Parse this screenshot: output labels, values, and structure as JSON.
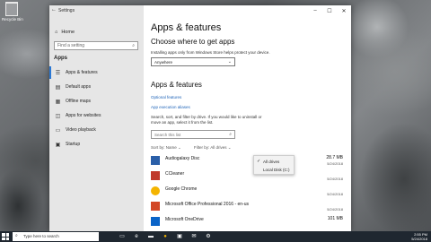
{
  "desktop": {
    "recycle_bin_label": "Recycle Bin"
  },
  "window": {
    "title": "Settings",
    "back_glyph": "←",
    "minimize_glyph": "–",
    "maximize_glyph": "☐",
    "close_glyph": "✕"
  },
  "sidebar": {
    "home_label": "Home",
    "search_placeholder": "Find a setting",
    "section_title": "Apps",
    "items": [
      {
        "label": "Apps & features",
        "icon": "list-icon",
        "active": true
      },
      {
        "label": "Default apps",
        "icon": "default-apps-icon"
      },
      {
        "label": "Offline maps",
        "icon": "map-icon"
      },
      {
        "label": "Apps for websites",
        "icon": "globe-icon"
      },
      {
        "label": "Video playback",
        "icon": "video-icon"
      },
      {
        "label": "Startup",
        "icon": "startup-icon"
      }
    ]
  },
  "main": {
    "page_title": "Apps & features",
    "install_heading": "Choose where to get apps",
    "install_desc": "Installing apps only from Windows Store helps protect your device.",
    "install_select_value": "Anywhere",
    "apps_heading": "Apps & features",
    "optional_features_link": "Optional features",
    "execution_aliases_link": "App execution aliases",
    "search_desc_line1": "Search, sort, and filter by drive. If you would like to uninstall or",
    "search_desc_line2": "move an app, select it from the list.",
    "list_search_placeholder": "Search this list",
    "sort_label": "Sort by: Name",
    "filter_label": "Filter by: All drives",
    "dropdown": {
      "options": [
        "All drives",
        "Local Disk (C:)"
      ],
      "selected": "All drives"
    },
    "apps": [
      {
        "name": "Audiogalaxy Disc",
        "size": "28.7 MB",
        "date": "5/24/2018",
        "color": "#2a5fa8"
      },
      {
        "name": "CCleaner",
        "size": "",
        "date": "5/24/2018",
        "color": "#c0392b"
      },
      {
        "name": "Google Chrome",
        "size": "",
        "date": "5/24/2018",
        "color": "#f4b400"
      },
      {
        "name": "Microsoft Office Professional 2016 - en-us",
        "size": "",
        "date": "5/24/2018",
        "color": "#d24726"
      },
      {
        "name": "Microsoft OneDrive",
        "size": "101 MB",
        "date": "",
        "color": "#0a64c8"
      }
    ]
  },
  "taskbar": {
    "search_placeholder": "Type here to search",
    "tray_time": "2:55 PM",
    "tray_date": "5/24/2018"
  }
}
